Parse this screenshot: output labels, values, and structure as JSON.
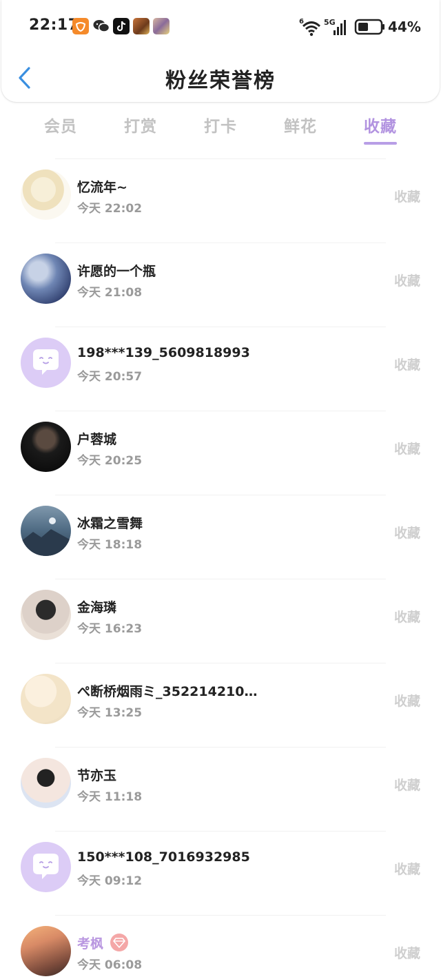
{
  "status_bar": {
    "time": "22:17",
    "battery": "44%",
    "network": "5G",
    "wifi_level": "6"
  },
  "nav": {
    "title": "粉丝荣誉榜"
  },
  "tabs": [
    {
      "label": "会员",
      "active": false
    },
    {
      "label": "打赏",
      "active": false
    },
    {
      "label": "打卡",
      "active": false
    },
    {
      "label": "鲜花",
      "active": false
    },
    {
      "label": "收藏",
      "active": true
    }
  ],
  "colors": {
    "accent": "#b293e0",
    "muted": "#c2c2c2",
    "action": "#cfcfcf",
    "vip_badge": "#f4a7a7"
  },
  "rows": [
    {
      "name": "忆流年~",
      "time": "今天 22:02",
      "action": "收藏"
    },
    {
      "name": "许愿的一个瓶",
      "time": "今天 21:08",
      "action": "收藏"
    },
    {
      "name": "198***139_5609818993",
      "time": "今天 20:57",
      "action": "收藏"
    },
    {
      "name": "户蓉城",
      "time": "今天 20:25",
      "action": "收藏"
    },
    {
      "name": "冰霜之雪舞",
      "time": "今天 18:18",
      "action": "收藏"
    },
    {
      "name": "金海璘",
      "time": "今天 16:23",
      "action": "收藏"
    },
    {
      "name": "ぺ断桥烟雨ミ_352214210…",
      "time": "今天 13:25",
      "action": "收藏"
    },
    {
      "name": "节亦玉",
      "time": "今天 11:18",
      "action": "收藏"
    },
    {
      "name": "150***108_7016932985",
      "time": "今天 09:12",
      "action": "收藏"
    },
    {
      "name": "考枫",
      "time": "今天 06:08",
      "action": "收藏",
      "vip": true
    }
  ]
}
